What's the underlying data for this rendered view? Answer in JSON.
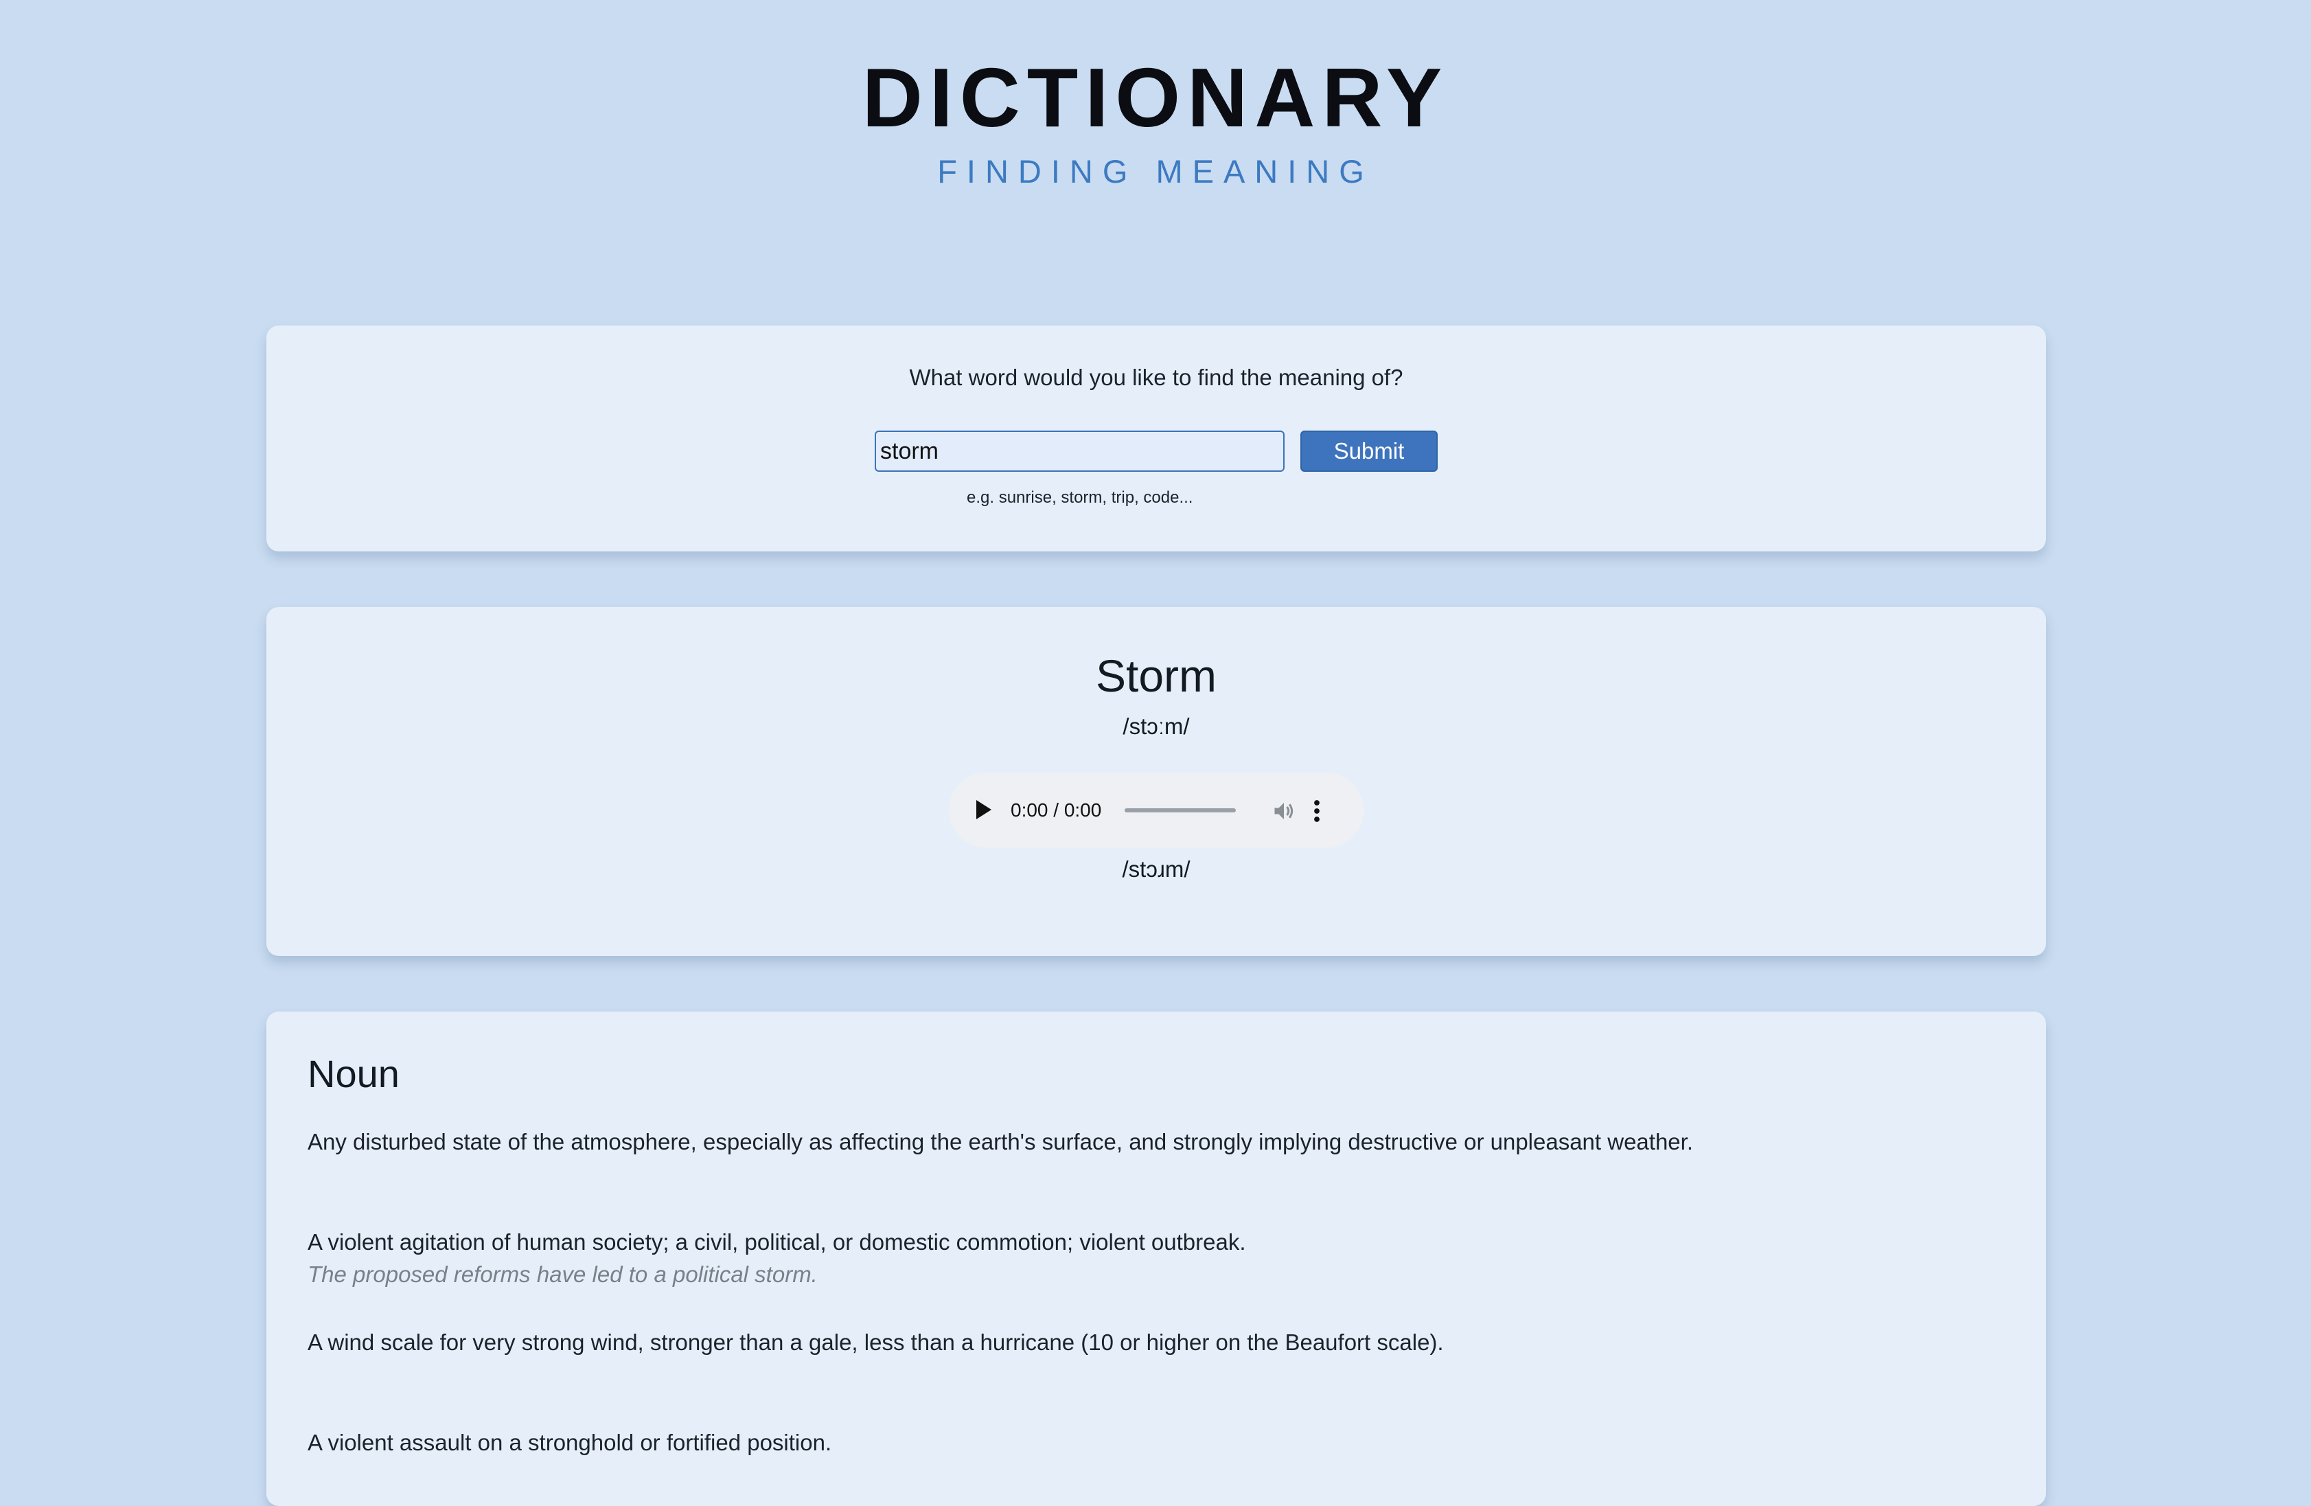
{
  "header": {
    "title": "DICTIONARY",
    "subtitle": "FINDING MEANING"
  },
  "search": {
    "prompt": "What word would you like to find the meaning of?",
    "input_value": "storm",
    "submit_label": "Submit",
    "hint": "e.g. sunrise, storm, trip, code..."
  },
  "word": {
    "title": "Storm",
    "phonetics": [
      "/stɔːm/",
      "/stɔɹm/"
    ],
    "audio": {
      "time": "0:00 / 0:00",
      "progress": 0
    }
  },
  "meanings": {
    "part_of_speech": "Noun",
    "definitions": [
      {
        "text": "Any disturbed state of the atmosphere, especially as affecting the earth's surface, and strongly implying destructive or unpleasant weather.",
        "example": ""
      },
      {
        "text": "A violent agitation of human society; a civil, political, or domestic commotion; violent outbreak.",
        "example": "The proposed reforms have led to a political storm."
      },
      {
        "text": "A wind scale for very strong wind, stronger than a gale, less than a hurricane (10 or higher on the Beaufort scale).",
        "example": ""
      },
      {
        "text": "A violent assault on a stronghold or fortified position.",
        "example": ""
      }
    ]
  },
  "colors": {
    "background": "#c9dcf1",
    "card": "#e6eff9",
    "accent": "#3e74bd",
    "subtitle": "#3c7ac2",
    "example_text": "#7a8089"
  },
  "icons": {
    "play": "play-icon",
    "volume": "volume-icon",
    "more": "more-vertical-icon"
  }
}
